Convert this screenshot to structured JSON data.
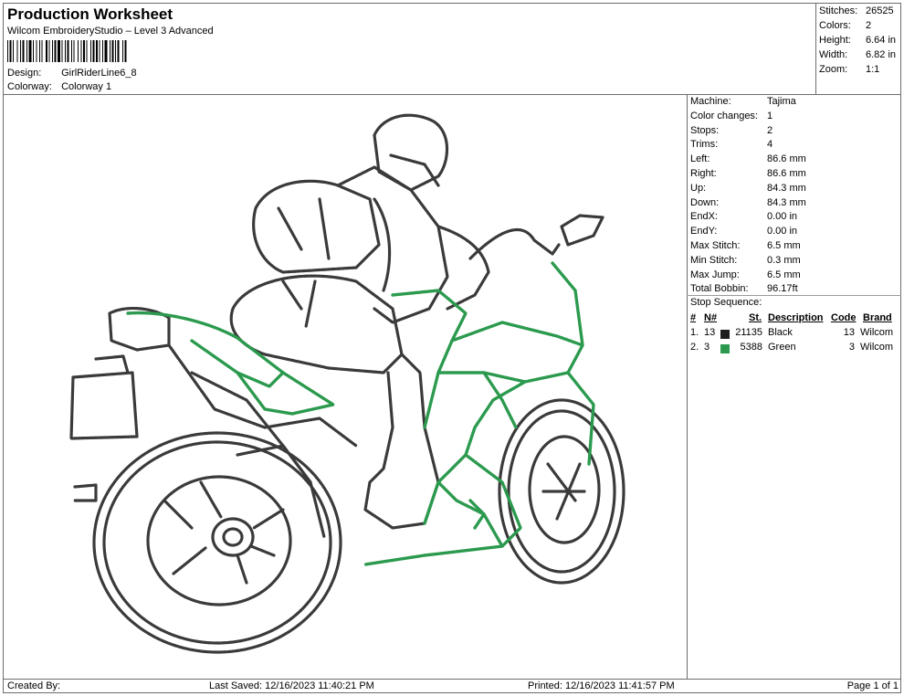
{
  "header": {
    "title": "Production Worksheet",
    "software": "Wilcom EmbroideryStudio – Level 3 Advanced",
    "design_label": "Design:",
    "design_value": "GirlRiderLine6_8",
    "colorway_label": "Colorway:",
    "colorway_value": "Colorway 1"
  },
  "summary": [
    {
      "label": "Stitches:",
      "value": "26525"
    },
    {
      "label": "Colors:",
      "value": "2"
    },
    {
      "label": "Height:",
      "value": "6.64 in"
    },
    {
      "label": "Width:",
      "value": "6.82 in"
    },
    {
      "label": "Zoom:",
      "value": "1:1"
    }
  ],
  "specs": [
    {
      "label": "Machine:",
      "value": "Tajima"
    },
    {
      "label": "Color changes:",
      "value": "1"
    },
    {
      "label": "Stops:",
      "value": "2"
    },
    {
      "label": "Trims:",
      "value": "4"
    },
    {
      "label": "Left:",
      "value": "86.6 mm"
    },
    {
      "label": "Right:",
      "value": "86.6 mm"
    },
    {
      "label": "Up:",
      "value": "84.3 mm"
    },
    {
      "label": "Down:",
      "value": "84.3 mm"
    },
    {
      "label": "EndX:",
      "value": "0.00 in"
    },
    {
      "label": "EndY:",
      "value": "0.00 in"
    },
    {
      "label": "Max Stitch:",
      "value": "6.5 mm"
    },
    {
      "label": "Min Stitch:",
      "value": "0.3 mm"
    },
    {
      "label": "Max Jump:",
      "value": "6.5 mm"
    },
    {
      "label": "Total Bobbin:",
      "value": "96.17ft"
    }
  ],
  "stop_sequence": {
    "title": "Stop Sequence:",
    "headers": {
      "num": "#",
      "n": "N#",
      "st": "St.",
      "desc": "Description",
      "code": "Code",
      "brand": "Brand"
    },
    "rows": [
      {
        "num": "1.",
        "n": "13",
        "color": "#1e1e1e",
        "st": "21135",
        "desc": "Black",
        "code": "13",
        "brand": "Wilcom"
      },
      {
        "num": "2.",
        "n": "3",
        "color": "#2b9a4e",
        "st": "5388",
        "desc": "Green",
        "code": "3",
        "brand": "Wilcom"
      }
    ]
  },
  "footer": {
    "created_by": "Created By:",
    "last_saved": "Last Saved: 12/16/2023 11:40:21 PM",
    "printed": "Printed: 12/16/2023 11:41:57 PM",
    "page": "Page 1 of 1"
  },
  "design_preview": {
    "icon": "motorcycle-rider-embroidery",
    "outline_color": "#3a3a3a",
    "accent_color": "#2b9a4e"
  }
}
